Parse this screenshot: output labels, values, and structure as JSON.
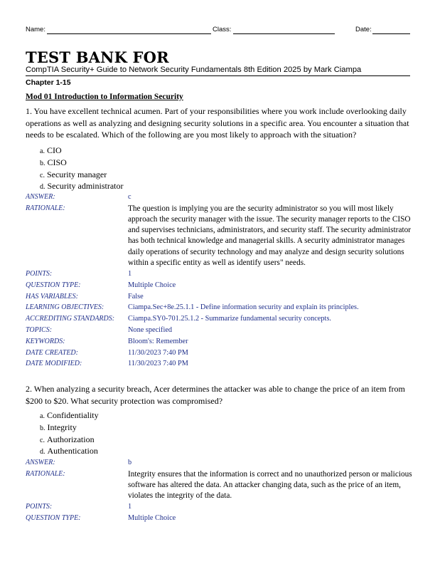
{
  "header": {
    "name_label": "Name:",
    "class_label": "Class:",
    "date_label": "Date:"
  },
  "title": {
    "main": "TEST BANK FOR",
    "subtitle": "CompTIA Security+ Guide to Network Security Fundamentals 8th Edition 2025 by Mark Ciampa",
    "chapter": "Chapter 1-15"
  },
  "module": "Mod 01 Introduction to Information Security",
  "questions": [
    {
      "text": "1. You have excellent technical acumen. Part of your responsibilities where you work include overlooking daily operations as well as analyzing and designing security solutions in a specific area. You encounter a situation that needs to be escalated. Which of the following are you most likely to approach with the situation?",
      "options": [
        {
          "letter": "a.",
          "text": "CIO"
        },
        {
          "letter": "b.",
          "text": "CISO"
        },
        {
          "letter": "c.",
          "text": "Security manager"
        },
        {
          "letter": "d.",
          "text": "Security administrator"
        }
      ],
      "meta": [
        {
          "key": "ANSWER:",
          "value": "c"
        },
        {
          "key": "RATIONALE:",
          "value": "The question is implying you are the security administrator so you will most likely approach the security manager with the issue. The security manager reports to the CISO and supervises technicians, administrators, and security staff. The security administrator has both technical knowledge and managerial skills. A security administrator manages daily operations of security technology and may analyze and design security solutions within a specific entity as well as identify users\" needs."
        },
        {
          "key": "POINTS:",
          "value": "1"
        },
        {
          "key": "QUESTION TYPE:",
          "value": "Multiple Choice"
        },
        {
          "key": "HAS VARIABLES:",
          "value": "False"
        },
        {
          "key": "LEARNING OBJECTIVES:",
          "value": "Ciampa.Sec+8e.25.1.1 - Define information security and explain its principles."
        },
        {
          "key": "ACCREDITING STANDARDS:",
          "value": "Ciampa.SY0-701.25.1.2 - Summarize fundamental security concepts."
        },
        {
          "key": "TOPICS:",
          "value": "None specified"
        },
        {
          "key": "KEYWORDS:",
          "value": "Bloom's: Remember"
        },
        {
          "key": "DATE CREATED:",
          "value": "11/30/2023 7:40 PM"
        },
        {
          "key": "DATE MODIFIED:",
          "value": "11/30/2023 7:40 PM"
        }
      ]
    },
    {
      "text": "2. When analyzing a security breach, Acer determines the attacker was able to change the price of an item from $200 to $20. What security protection was compromised?",
      "options": [
        {
          "letter": "a.",
          "text": "Confidentiality"
        },
        {
          "letter": "b.",
          "text": "Integrity"
        },
        {
          "letter": "c.",
          "text": "Authorization"
        },
        {
          "letter": "d.",
          "text": "Authentication"
        }
      ],
      "meta": [
        {
          "key": "ANSWER:",
          "value": "b"
        },
        {
          "key": "RATIONALE:",
          "value": "Integrity ensures that the information is correct and no unauthorized person or malicious software has altered the data. An attacker changing data, such as the price of an item, violates the integrity of the data."
        },
        {
          "key": "POINTS:",
          "value": "1"
        },
        {
          "key": "QUESTION TYPE:",
          "value": "Multiple Choice"
        }
      ]
    }
  ]
}
